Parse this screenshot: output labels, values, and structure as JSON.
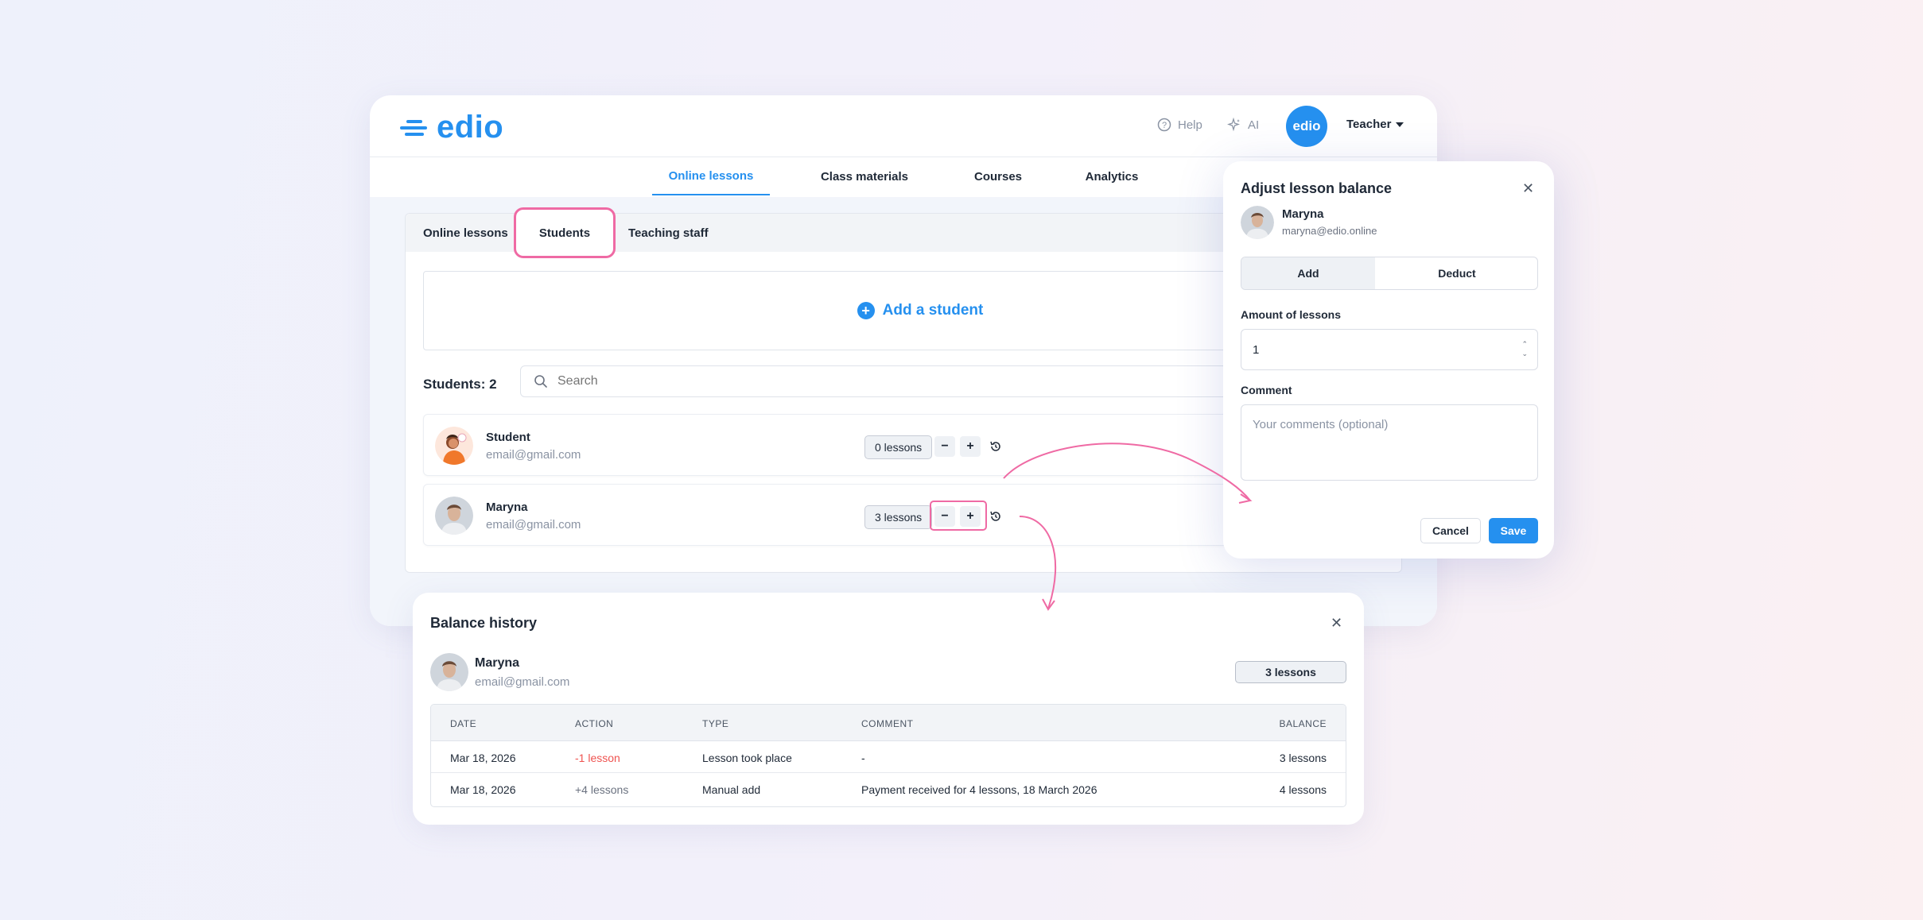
{
  "app": {
    "logo": "edio",
    "header": {
      "help_label": "Help",
      "ai_label": "AI",
      "avatar_text": "edio",
      "user_role": "Teacher"
    },
    "main_tabs": [
      {
        "label": "Online lessons",
        "active": true
      },
      {
        "label": "Class materials",
        "active": false
      },
      {
        "label": "Courses",
        "active": false
      },
      {
        "label": "Analytics",
        "active": false
      }
    ],
    "sub_tabs": [
      {
        "label": "Online lessons",
        "active": false
      },
      {
        "label": "Students",
        "active": true
      },
      {
        "label": "Teaching staff",
        "active": false
      }
    ],
    "add_student_label": "Add a student",
    "students_count_label": "Students: 2",
    "search_placeholder": "Search",
    "students": [
      {
        "name": "Student",
        "email": "email@gmail.com",
        "balance": "0 lessons"
      },
      {
        "name": "Maryna",
        "email": "email@gmail.com",
        "balance": "3 lessons"
      }
    ]
  },
  "adjust_modal": {
    "title": "Adjust lesson balance",
    "user_name": "Maryna",
    "user_email": "maryna@edio.online",
    "add_label": "Add",
    "deduct_label": "Deduct",
    "amount_label": "Amount of lessons",
    "amount_value": "1",
    "comment_label": "Comment",
    "comment_placeholder": "Your comments (optional)",
    "cancel_label": "Cancel",
    "save_label": "Save"
  },
  "balance_history": {
    "title": "Balance history",
    "user_name": "Maryna",
    "user_email": "email@gmail.com",
    "balance_badge": "3 lessons",
    "columns": [
      "Date",
      "Action",
      "Type",
      "Comment",
      "Balance"
    ],
    "rows": [
      {
        "date": "Mar 18, 2026",
        "action": "-1 lesson",
        "type": "Lesson took place",
        "comment": "-",
        "balance": "3 lessons"
      },
      {
        "date": "Mar 18, 2026",
        "action": "+4 lessons",
        "type": "Manual add",
        "comment": "Payment received for 4 lessons, 18 March 2026",
        "balance": "4 lessons"
      }
    ]
  },
  "colors": {
    "accent": "#2590ef",
    "highlight": "#ef6aa4",
    "negative": "#ef5350"
  },
  "icons": [
    "help-icon",
    "sparkle-icon",
    "search-icon",
    "plus-circle-icon",
    "history-icon",
    "close-icon"
  ]
}
